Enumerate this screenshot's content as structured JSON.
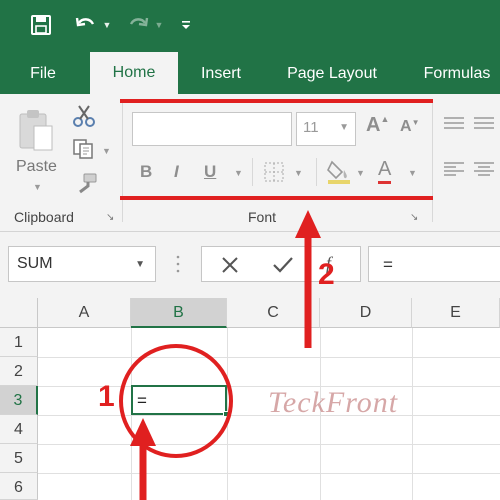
{
  "quick_access": {
    "save_icon": "save-icon",
    "undo_icon": "undo-icon",
    "redo_icon": "redo-icon",
    "customize_icon": "customize-qat-icon"
  },
  "tabs": [
    {
      "label": "File"
    },
    {
      "label": "Home"
    },
    {
      "label": "Insert"
    },
    {
      "label": "Page Layout"
    },
    {
      "label": "Formulas"
    }
  ],
  "ribbon": {
    "clipboard": {
      "paste_label": "Paste",
      "group_label": "Clipboard"
    },
    "font": {
      "font_name": "",
      "font_size": "11",
      "bold": "B",
      "italic": "I",
      "underline": "U",
      "font_color_letter": "A",
      "grow_letter": "A",
      "shrink_letter": "A",
      "group_label": "Font"
    }
  },
  "formula_bar": {
    "name_box": "SUM",
    "cancel_icon": "cancel-icon",
    "enter_icon": "check-icon",
    "formula": "="
  },
  "grid": {
    "columns": [
      "A",
      "B",
      "C",
      "D",
      "E"
    ],
    "rows": [
      "1",
      "2",
      "3",
      "4",
      "5",
      "6"
    ],
    "active_cell_value": "=",
    "selected_column": "B",
    "selected_row": "3"
  },
  "watermark": "TeckFront",
  "annotations": {
    "label_1": "1",
    "label_2": "2"
  },
  "colors": {
    "excel_green": "#217346",
    "annotation_red": "#e02020"
  }
}
